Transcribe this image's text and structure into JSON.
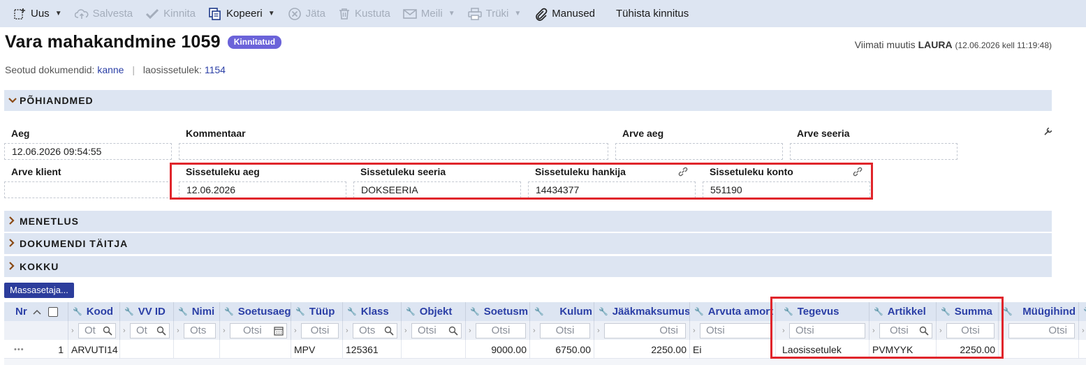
{
  "toolbar": {
    "new": "Uus",
    "save": "Salvesta",
    "confirm": "Kinnita",
    "copy": "Kopeeri",
    "skip": "Jäta",
    "delete": "Kustuta",
    "mail": "Meili",
    "print": "Trüki",
    "attachments": "Manused",
    "cancel_confirm": "Tühista kinnitus"
  },
  "header": {
    "title": "Vara mahakandmine 1059",
    "status": "Kinnitatud",
    "last_modified_prefix": "Viimati muutis",
    "last_modified_user": "LAURA",
    "last_modified_time": "(12.06.2026 kell 11:19:48)"
  },
  "related": {
    "label": "Seotud dokumendid:",
    "link1": "kanne",
    "separator": "|",
    "label2": "laosissetulek:",
    "link2": "1154"
  },
  "sections": {
    "main": "PÕHIANDMED",
    "procedure": "MENETLUS",
    "executor": "DOKUMENDI TÄITJA",
    "total": "KOKKU"
  },
  "fields": {
    "aeg": {
      "label": "Aeg",
      "value": "12.06.2026 09:54:55"
    },
    "kommentaar": {
      "label": "Kommentaar",
      "value": ""
    },
    "arve_aeg": {
      "label": "Arve aeg",
      "value": ""
    },
    "arve_seeria": {
      "label": "Arve seeria",
      "value": ""
    },
    "arve_klient": {
      "label": "Arve klient",
      "value": ""
    },
    "sissetuleku_aeg": {
      "label": "Sissetuleku aeg",
      "value": "12.06.2026"
    },
    "sissetuleku_seeria": {
      "label": "Sissetuleku seeria",
      "value": "DOKSEERIA"
    },
    "sissetuleku_hankija": {
      "label": "Sissetuleku hankija",
      "value": "14434377"
    },
    "sissetuleku_konto": {
      "label": "Sissetuleku konto",
      "value": "551190"
    }
  },
  "mass_button": "Massasetaja...",
  "grid": {
    "columns": {
      "nr": "Nr",
      "kood": "Kood",
      "vv_id": "VV ID",
      "nimi": "Nimi",
      "soetusaeg": "Soetusaeg",
      "tyyp": "Tüüp",
      "klass": "Klass",
      "objekt": "Objekt",
      "soetusm": "Soetusm",
      "kulum": "Kulum",
      "jaakmaksumus": "Jääkmaksumus",
      "arvuta_amort": "Arvuta amort",
      "tegevus": "Tegevus",
      "artikkel": "Artikkel",
      "summa": "Summa",
      "myygihind": "Müügihind"
    },
    "filter_placeholder": "Otsi",
    "filter_short": "Ot",
    "filter_short2": "Ots",
    "row": {
      "menu": "•••",
      "nr": "1",
      "kood": "ARVUTI14",
      "tyyp": "MPV",
      "klass": "125361",
      "soetusm": "9000.00",
      "kulum": "6750.00",
      "jaakmaksumus": "2250.00",
      "arvuta_amort": "Ei",
      "tegevus": "Laosissetulek",
      "artikkel": "PVMYYK",
      "summa": "2250.00"
    }
  }
}
